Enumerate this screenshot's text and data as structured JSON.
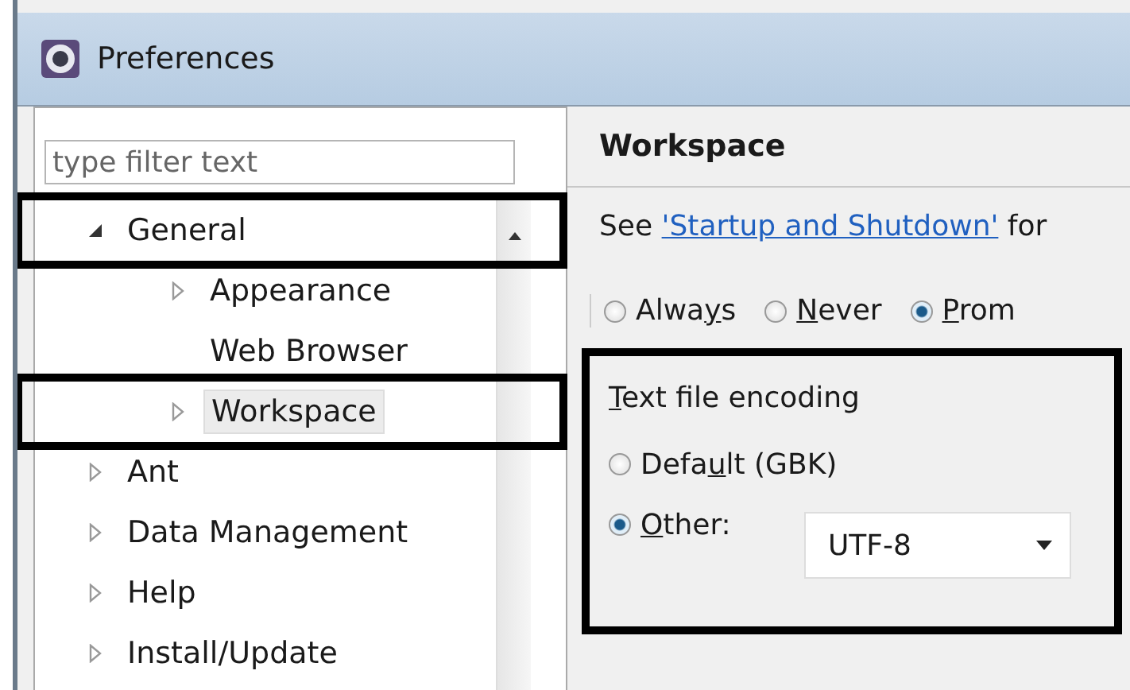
{
  "window": {
    "title": "Preferences"
  },
  "filter": {
    "placeholder": "type filter text"
  },
  "tree": [
    {
      "label": "General",
      "expanded": true,
      "selected": false,
      "highlighted": true,
      "children": [
        {
          "label": "Appearance",
          "expanded": false,
          "selected": false,
          "highlighted": false
        },
        {
          "label": "Web Browser",
          "selected": false,
          "highlighted": false
        },
        {
          "label": "Workspace",
          "expanded": false,
          "selected": true,
          "highlighted": true
        }
      ]
    },
    {
      "label": "Ant",
      "expanded": false,
      "selected": false,
      "highlighted": false
    },
    {
      "label": "Data Management",
      "expanded": false,
      "selected": false,
      "highlighted": false
    },
    {
      "label": "Help",
      "expanded": false,
      "selected": false,
      "highlighted": false
    },
    {
      "label": "Install/Update",
      "expanded": false,
      "selected": false,
      "highlighted": false
    }
  ],
  "page": {
    "title": "Workspace",
    "intro": {
      "before": "See ",
      "link": "'Startup and Shutdown'",
      "after": " for"
    },
    "radios": [
      {
        "before": "Alwa",
        "key": "y",
        "after": "s",
        "selected": false
      },
      {
        "key": "N",
        "after": "ever",
        "selected": false
      },
      {
        "key": "P",
        "after": "rom",
        "selected": true
      }
    ],
    "encoding": {
      "highlighted": true,
      "title": {
        "key": "T",
        "after": "ext file encoding"
      },
      "options": [
        {
          "before": "Defa",
          "key": "u",
          "after": "lt (GBK)",
          "selected": false
        },
        {
          "key": "O",
          "after": "ther:",
          "selected": true
        }
      ],
      "combo": {
        "value": "UTF-8"
      }
    }
  }
}
